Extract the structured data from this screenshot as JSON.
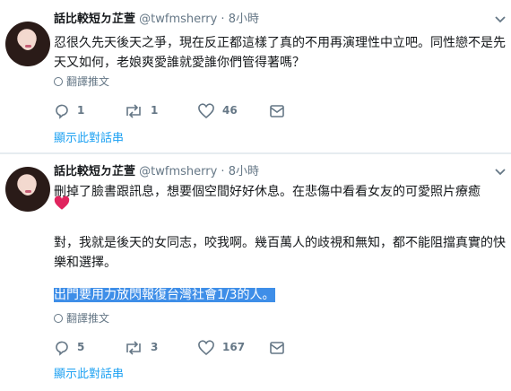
{
  "tweets": [
    {
      "name": "話比較短ㄉ芷萱",
      "handle": "@twfmsherry",
      "time": "8小時",
      "text_lines": [
        "忍很久先天後天之爭，現在反正都這樣了真的不用再演理性中立吧。同性戀不是先",
        "天又如何，老娘爽愛誰就愛誰你們管得著嗎？"
      ],
      "translate_label": "翻譯推文",
      "replies": "1",
      "retweets": "1",
      "likes": "46",
      "show_thread": "顯示此對話串"
    },
    {
      "name": "話比較短ㄉ芷萱",
      "handle": "@twfmsherry",
      "time": "8小時",
      "text_line1": "刪掉了臉書跟訊息，想要個空間好好休息。在悲傷中看看女友的可愛照片療癒",
      "text_line2": "對，我就是後天的女同志，咬我啊。幾百萬人的歧視和無知，都不能阻擋真實的快",
      "text_line3": "樂和選擇。",
      "text_highlight": "出門要用力放閃報復台灣社會1/3的人。",
      "translate_label": "翻譯推文",
      "replies": "5",
      "retweets": "3",
      "likes": "167",
      "show_thread": "顯示此對話串"
    }
  ],
  "header_sep": " · ",
  "icons": {
    "reply": "reply-icon",
    "retweet": "retweet-icon",
    "like": "heart-icon",
    "dm": "envelope-icon",
    "caret": "chevron-down-icon",
    "globe": "globe-icon",
    "heart_emoji": "red-heart-emoji"
  },
  "colors": {
    "link": "#1da1f2",
    "muted": "#657786",
    "highlight": "#3e8ee8",
    "heart": "#e0245e"
  }
}
